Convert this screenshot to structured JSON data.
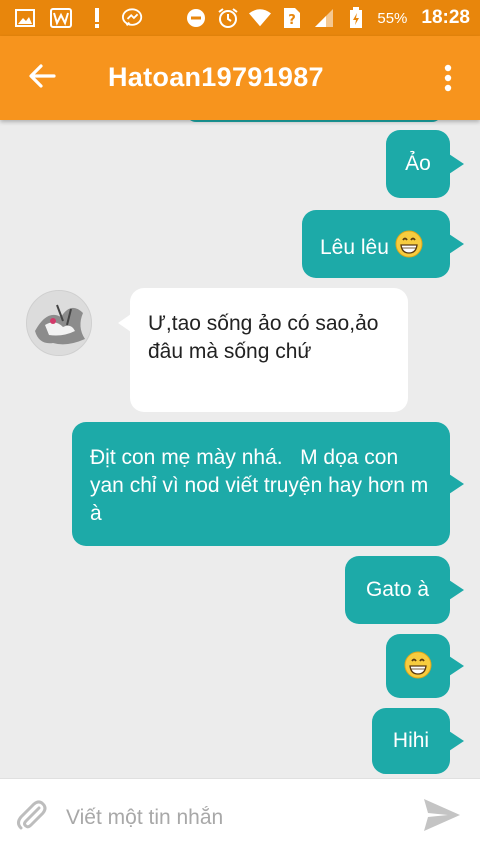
{
  "status_bar": {
    "icons": [
      "image-icon",
      "w-app-icon",
      "alert-icon",
      "messenger-icon",
      "minus-circle-icon",
      "alarm-icon",
      "wifi-icon",
      "no-sim-icon",
      "signal-icon",
      "battery-icon"
    ],
    "battery": "55%",
    "time": "18:28"
  },
  "header": {
    "title": "Hatoan19791987"
  },
  "messages": [
    {
      "side": "out",
      "text": "Ảo"
    },
    {
      "side": "out",
      "text": "Lêu lêu",
      "emoji": "grin-emoji"
    },
    {
      "side": "in",
      "text": "Ư,tao sống ảo có sao,ảo đâu mà sống chứ"
    },
    {
      "side": "out",
      "text": "Địt con mẹ mày nhá.   M dọa con yan chỉ vì nod viết truyện hay hơn m à"
    },
    {
      "side": "out",
      "text": "Gato à"
    },
    {
      "side": "out",
      "text": "",
      "emoji": "grin-emoji"
    },
    {
      "side": "out",
      "text": "Hihi"
    }
  ],
  "composer": {
    "placeholder": "Viết một tin nhắn",
    "value": ""
  },
  "colors": {
    "status_bar": "#e8860c",
    "app_bar": "#f7941d",
    "outgoing_bubble": "#1daaa8",
    "incoming_bubble": "#ffffff",
    "chat_background": "#ececec"
  }
}
